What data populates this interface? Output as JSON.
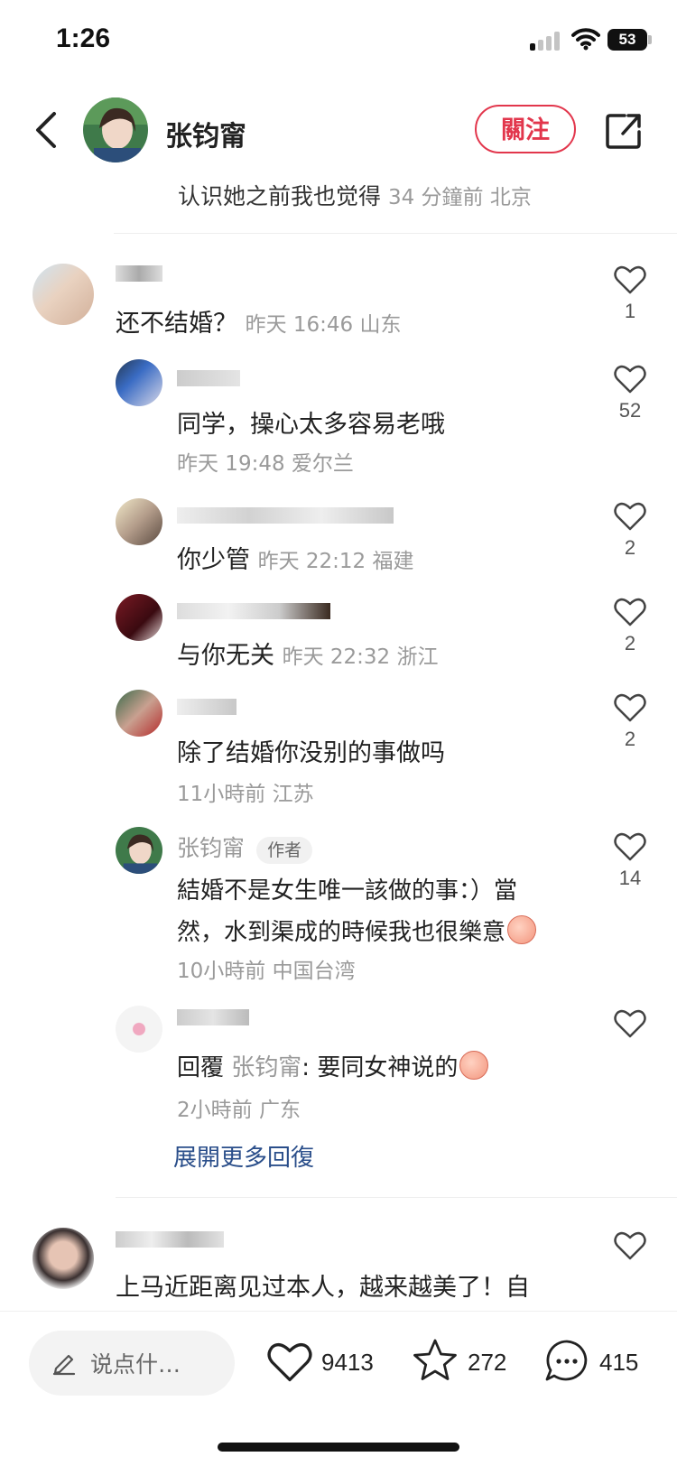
{
  "status_bar": {
    "time": "1:26",
    "battery": "53"
  },
  "header": {
    "author_name": "张钧甯",
    "follow_label": "關注"
  },
  "previous_comment": {
    "text": "认识她之前我也觉得",
    "meta": "34 分鐘前 北京"
  },
  "comments": [
    {
      "text": "还不结婚？",
      "meta": "昨天 16:46 山东",
      "likes": "1"
    }
  ],
  "replies": [
    {
      "text": "同学，操心太多容易老哦",
      "meta": "昨天 19:48 爱尔兰",
      "likes": "52"
    },
    {
      "text": "你少管",
      "meta": "昨天 22:12 福建",
      "likes": "2"
    },
    {
      "text": "与你无关",
      "meta": "昨天 22:32 浙江",
      "likes": "2"
    },
    {
      "text": "除了结婚你没别的事做吗",
      "meta": "11小時前 江苏",
      "likes": "2"
    },
    {
      "author": "张钧甯",
      "tag": "作者",
      "line1": "結婚不是女生唯一該做的事：）當",
      "line2": "然，水到渠成的時候我也很樂意",
      "meta": "10小時前 中国台湾",
      "likes": "14"
    },
    {
      "prefix": "回覆",
      "mention": "张钧甯",
      "text": ": 要同女神说的",
      "meta": "2小時前 广东"
    }
  ],
  "expand_more": "展開更多回復",
  "next_comment": {
    "text": "上马近距离见过本人，越来越美了！自"
  },
  "bottom_bar": {
    "input_placeholder": "说点什…",
    "likes": "9413",
    "favorites": "272",
    "comments": "415"
  },
  "colors": {
    "accent": "#e2364c",
    "link": "#2a4e8a",
    "meta": "#9a9a9a"
  }
}
